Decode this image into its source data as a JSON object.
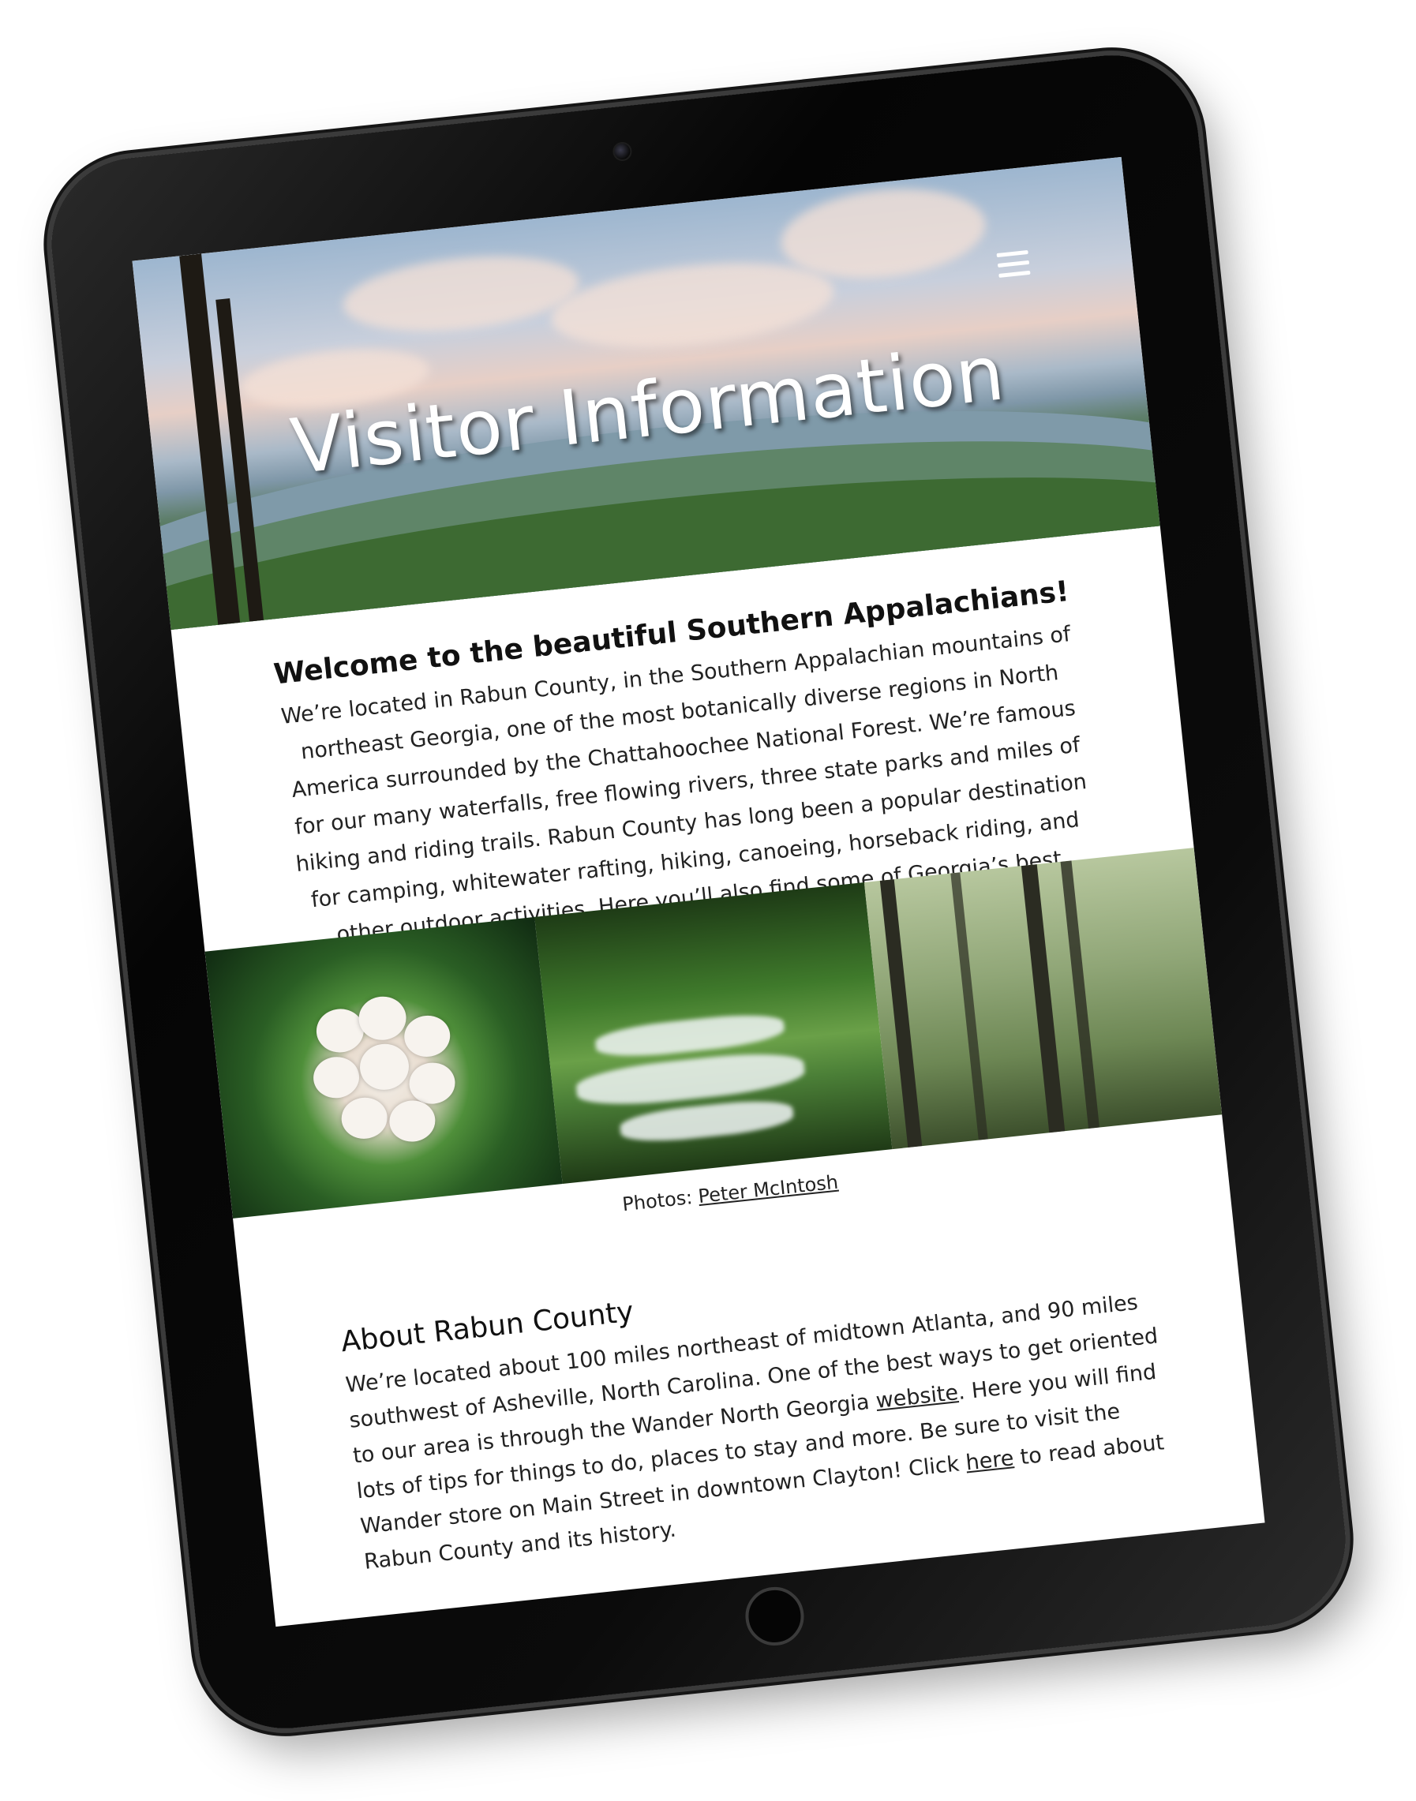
{
  "hero": {
    "title": "Visitor Information",
    "menu_icon": "hamburger-menu-icon"
  },
  "welcome": {
    "heading": "Welcome to the beautiful Southern Appalachians!",
    "body": "We’re located in Rabun County, in the Southern Appalachian mountains of northeast Georgia, one of the most botanically diverse regions in North America surrounded by the Chattahoochee National Forest. We’re famous for our many waterfalls, free flowing rivers, three state parks and miles of hiking and riding trails. Rabun County has long been a popular destination for camping, whitewater rafting, hiking, canoeing, horseback riding, and other outdoor activities. Here you’ll also find some of Georgia’s best restaurants, seasonal farm stands bursting with local produce and several award-winning wineries."
  },
  "gallery": {
    "caption_prefix": "Photos: ",
    "caption_link": "Peter McIntosh"
  },
  "about": {
    "heading": "About Rabun County",
    "text_1": "We’re located  about 100 miles northeast of midtown Atlanta, and 90 miles southwest of Asheville, North Carolina. One of the best ways to get oriented to our area is through the Wander North Georgia ",
    "link_1": "website",
    "text_2": ". Here you will find lots of tips for things to do, places to stay and more. Be sure to visit the Wander store on Main Street in downtown Clayton!  Click ",
    "link_2": "here",
    "text_3": " to read about Rabun County and its history."
  }
}
